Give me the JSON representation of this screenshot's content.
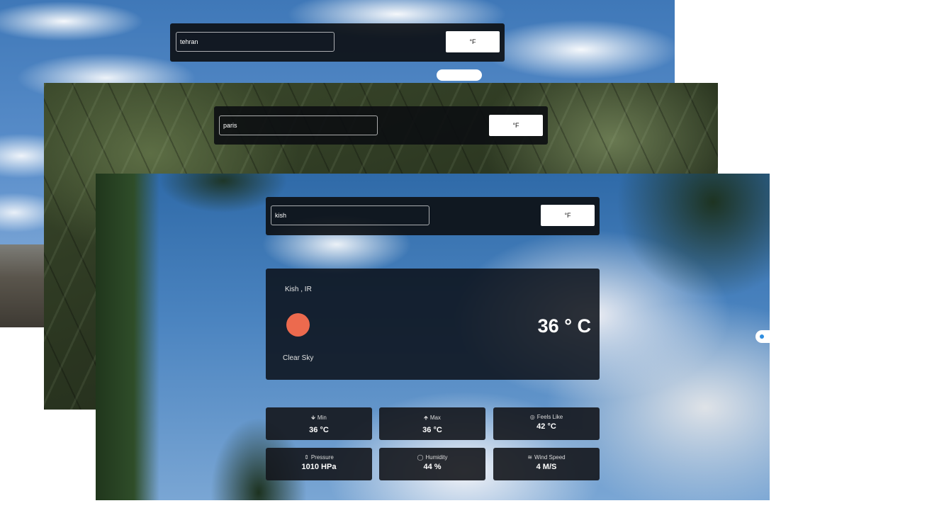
{
  "screens": {
    "back": {
      "search_value": "tehran",
      "button_label": "°F"
    },
    "middle": {
      "search_value": "paris",
      "button_label": "°F"
    },
    "front": {
      "search_value": "kish",
      "button_label": "°F"
    }
  },
  "weather": {
    "location": "Kish , IR",
    "icon": "sun-icon",
    "temperature": "36 ° C",
    "condition": "Clear Sky"
  },
  "stats": [
    {
      "icon": "arrow-down-icon",
      "glyph": "🡻",
      "label": "Min",
      "value": "36 °C"
    },
    {
      "icon": "arrow-up-icon",
      "glyph": "🡹",
      "label": "Max",
      "value": "36 °C"
    },
    {
      "icon": "feels-like-icon",
      "glyph": "◎",
      "label": "Feels Like",
      "value": "42 °C"
    },
    {
      "icon": "pressure-icon",
      "glyph": "⇕",
      "label": "Pressure",
      "value": "1010 HPa"
    },
    {
      "icon": "humidity-icon",
      "glyph": "◯",
      "label": "Humidity",
      "value": "44 %"
    },
    {
      "icon": "wind-icon",
      "glyph": "≋",
      "label": "Wind Speed",
      "value": "4 M/S"
    }
  ],
  "colors": {
    "sun": "#ec6a4e",
    "panel": "#0c1018",
    "button": "#ffffff"
  }
}
